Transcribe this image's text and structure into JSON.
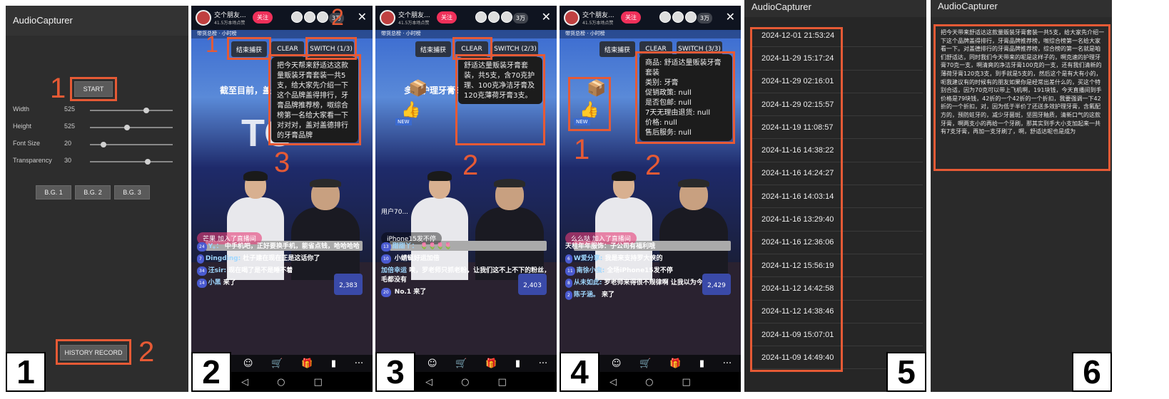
{
  "panel1": {
    "title": "AudioCapturer",
    "start_label": "START",
    "sliders": [
      {
        "label": "Width",
        "value": "525",
        "fraction": 0.68
      },
      {
        "label": "Height",
        "value": "525",
        "fraction": 0.45
      },
      {
        "label": "Font Size",
        "value": "20",
        "fraction": 0.16
      },
      {
        "label": "Transparency",
        "value": "30",
        "fraction": 0.7
      }
    ],
    "bg_buttons": [
      "B.G. 1",
      "B.G. 2",
      "B.G. 3"
    ],
    "history_label": "HISTORY RECORD",
    "marker1": "1",
    "marker2": "2",
    "panel_number": "1"
  },
  "phone_common": {
    "host_name": "交个朋友...",
    "host_sub": "41.5万本场点赞",
    "follow": "关注",
    "viewers": "3万",
    "close": "✕",
    "subbar": "带货总榜 · 小时榜",
    "btn_end": "结束捕获",
    "btn_clear": "CLEAR",
    "nav_back": "◁",
    "nav_home": "○",
    "nav_recent": "□",
    "bottom_icons": [
      "☺",
      "🛒",
      "🎁",
      "▮",
      "···"
    ]
  },
  "panel2": {
    "switch": "SWITCH (1/3)",
    "popup": "把今天帮来舒适达这款量贩装牙膏套装一共5支，给大家先介绍一下这个品牌盖得排行，牙膏品牌推荐榜，呶综合榜第一名给大家看一下对对对，盖对盖德排行的牙膏品牌",
    "bigtext": "TO",
    "banner": "截至目前，盖得排行",
    "joined": "芒果 加入了直播间",
    "chat": [
      {
        "badge": "24",
        "nick": "Y。：",
        "text": "中手机吧，正好要换手机，能省点钱，哈哈哈哈"
      },
      {
        "badge": "7",
        "nick": "Dingding:",
        "text": "杜子建在现在正是这话你了"
      },
      {
        "badge": "34",
        "nick": "汪sir:",
        "text": "现在喝了是不是睡不着"
      },
      {
        "badge": "14",
        "nick": "小黑",
        "text": "来了"
      }
    ],
    "ticket": "2,383",
    "marker1": "1",
    "marker2": "2",
    "marker3": "3",
    "panel_number": "2"
  },
  "panel3": {
    "switch": "SWITCH (2/3)",
    "popup": "舒适达量贩装牙膏套装，共5支，含70克护理、100克净洁牙膏及120克薄荷牙膏3支。",
    "user_label": "用户70...",
    "big_label": "多效护理牙膏30",
    "joined": "iPhone15发不停",
    "chat": [
      {
        "badge": "13",
        "nick": "甜甜丫：",
        "text": "🌷🌷🌷🌷"
      },
      {
        "badge": "10",
        "nick": "",
        "text": "小蜻蜓好运加倍"
      },
      {
        "badge": "",
        "nick": "加倍幸运",
        "text": "唉，罗老师只抓老粉，让我们这不上不下的粉丝，毛都没有"
      },
      {
        "badge": "20",
        "nick": "",
        "text": "No.1 来了"
      }
    ],
    "ticket": "2,403",
    "marker2": "2",
    "panel_number": "3"
  },
  "panel4": {
    "switch": "SWITCH (3/3)",
    "popup": "商品: 舒适达量贩装牙膏套装\n类别: 牙膏\n促销政策: null\n是否包邮: null\n7天无理由退货: null\n价格: null\n售后服务: null",
    "joined": "么么哒 加入了直播间",
    "chat": [
      {
        "badge": "",
        "nick": "",
        "text": "天柱年年服饰：子公司有福利哦"
      },
      {
        "badge": "6",
        "nick": "W爱分享:",
        "text": "我是来支持罗大侠的"
      },
      {
        "badge": "11",
        "nick": "南徐小虫:",
        "text": "全场iPhone15发不停"
      },
      {
        "badge": "8",
        "nick": "从未如此:",
        "text": "罗老师来得很不规律啊 让我以为今天周五"
      },
      {
        "badge": "2",
        "nick": "陈子涵。",
        "text": "来了"
      }
    ],
    "ticket": "2,429",
    "new_tag": "NEW",
    "marker1": "1",
    "marker2": "2",
    "panel_number": "4"
  },
  "panel5": {
    "title": "AudioCapturer",
    "records": [
      "2024-12-01 21:53:24",
      "2024-11-29 15:17:24",
      "2024-11-29 02:16:01",
      "2024-11-29 02:15:57",
      "2024-11-19 11:08:57",
      "2024-11-16 14:38:22",
      "2024-11-16 14:24:27",
      "2024-11-16 14:03:14",
      "2024-11-16 13:29:40",
      "2024-11-16 12:36:06",
      "2024-11-12 15:56:19",
      "2024-11-12 14:42:58",
      "2024-11-12 14:38:46",
      "2024-11-09 15:07:01",
      "2024-11-09 14:49:40"
    ],
    "panel_number": "5"
  },
  "panel6": {
    "title": "AudioCapturer",
    "transcript": "把今天带来舒适达这款量贩装牙膏套装一共5支，给大家先介绍一下这个品牌盖得排行，牙膏品牌推荐榜，呶综合榜第一名给大家看一下。对盖德排行的牙膏品牌推荐榜，综合榜的第一名就是咱们舒适达，同时我们今天带来的呢是这样子的，啊克速的护理牙膏70克一支，啊清爽的净洁牙膏100克的一支，还有我们清新的薄荷牙膏120克3支，到手就是5支的，然后这个是有大有小的，呃我建议有的时候有的朋友如果你是经常出差什么的，买这个特别合适，因为70克可以带上飞机啊，191块钱，今天直播间到手价格是79块钱，42折的一个42折的一个折扣，我要强调一下42折的一个折扣，对，因为低于半价了还送多效护理牙膏，含氟配方的，预防蛀牙的，减少牙菌斑，坚固牙釉质，清新口气的这款牙膏，啊两支小的再给一个牙刷，那其实到手大小支加起来一共有7支牙膏，再加一支牙刷了，啊，舒适达呢也是成为",
    "panel_number": "6"
  },
  "colors": {
    "accent": "#e65a35",
    "dark_panel": "#2d2d2d",
    "follow": "#f0305a"
  }
}
